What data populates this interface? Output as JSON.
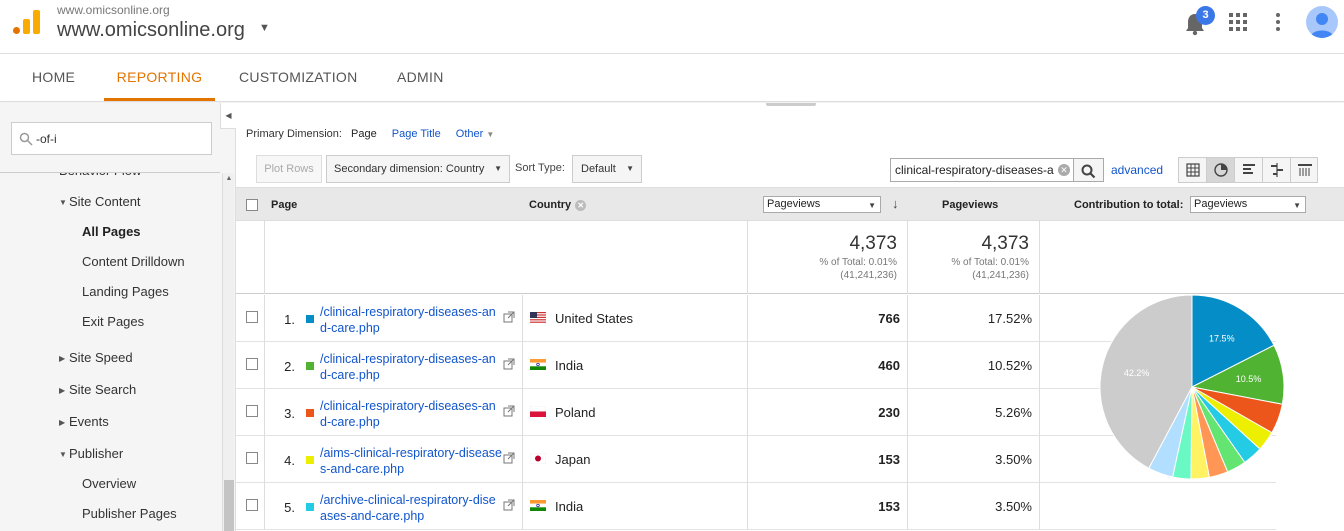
{
  "header": {
    "site_small": "www.omicsonline.org",
    "site_big": "www.omicsonline.org",
    "notification_count": "3"
  },
  "nav": {
    "tabs": [
      "HOME",
      "REPORTING",
      "CUSTOMIZATION",
      "ADMIN"
    ],
    "active": "REPORTING"
  },
  "sidebar": {
    "search_value": "-of-i",
    "items": [
      {
        "label": "Behavior Flow",
        "level": 1
      },
      {
        "label": "Site Content",
        "level": 1,
        "expanded": true
      },
      {
        "label": "All Pages",
        "level": 2,
        "active": true
      },
      {
        "label": "Content Drilldown",
        "level": 2
      },
      {
        "label": "Landing Pages",
        "level": 2
      },
      {
        "label": "Exit Pages",
        "level": 2
      },
      {
        "label": "Site Speed",
        "level": 1
      },
      {
        "label": "Site Search",
        "level": 1
      },
      {
        "label": "Events",
        "level": 1
      },
      {
        "label": "Publisher",
        "level": 1,
        "expanded": true
      },
      {
        "label": "Overview",
        "level": 2
      },
      {
        "label": "Publisher Pages",
        "level": 2
      }
    ]
  },
  "main": {
    "primary_dimension_label": "Primary Dimension:",
    "primary_dimension_options": [
      "Page",
      "Page Title",
      "Other"
    ],
    "plot_rows_label": "Plot Rows",
    "secondary_dimension_label": "Secondary dimension: Country",
    "sort_type_label": "Sort Type:",
    "sort_type_value": "Default",
    "filter_value": "clinical-respiratory-diseases-a",
    "advanced_label": "advanced"
  },
  "table": {
    "col_page": "Page",
    "col_country": "Country",
    "metric_select": "Pageviews",
    "col_pageviews": "Pageviews",
    "col_contribution": "Contribution to total:",
    "contribution_select": "Pageviews",
    "totals": {
      "value1": "4,373",
      "pct1": "% of Total: 0.01%",
      "abs1": "(41,241,236)",
      "value2": "4,373",
      "pct2": "% of Total: 0.01%",
      "abs2": "(41,241,236)"
    },
    "rows": [
      {
        "idx": "1.",
        "page": "/clinical-respiratory-diseases-and-care.php",
        "country": "United States",
        "pageviews": "766",
        "percent": "17.52%",
        "color": "#058dc7",
        "flag": "us"
      },
      {
        "idx": "2.",
        "page": "/clinical-respiratory-diseases-and-care.php",
        "country": "India",
        "pageviews": "460",
        "percent": "10.52%",
        "color": "#50b432",
        "flag": "in"
      },
      {
        "idx": "3.",
        "page": "/clinical-respiratory-diseases-and-care.php",
        "country": "Poland",
        "pageviews": "230",
        "percent": "5.26%",
        "color": "#ed561b",
        "flag": "pl"
      },
      {
        "idx": "4.",
        "page": "/aims-clinical-respiratory-diseases-and-care.php",
        "country": "Japan",
        "pageviews": "153",
        "percent": "3.50%",
        "color": "#edef00",
        "flag": "jp"
      },
      {
        "idx": "5.",
        "page": "/archive-clinical-respiratory-diseases-and-care.php",
        "country": "India",
        "pageviews": "153",
        "percent": "3.50%",
        "color": "#24cbe5",
        "flag": "in"
      }
    ]
  },
  "chart_data": {
    "type": "pie",
    "slices": [
      {
        "value": 17.5,
        "label": "17.5%",
        "color": "#058dc7"
      },
      {
        "value": 10.5,
        "label": "10.5%",
        "color": "#50b432"
      },
      {
        "value": 5.26,
        "label": "",
        "color": "#ed561b"
      },
      {
        "value": 3.5,
        "label": "",
        "color": "#edef00"
      },
      {
        "value": 3.5,
        "label": "",
        "color": "#24cbe5"
      },
      {
        "value": 3.4,
        "label": "",
        "color": "#64e572"
      },
      {
        "value": 3.3,
        "label": "",
        "color": "#ff9655"
      },
      {
        "value": 3.2,
        "label": "",
        "color": "#fff263"
      },
      {
        "value": 3.2,
        "label": "",
        "color": "#6af9c4"
      },
      {
        "value": 4.4,
        "label": "",
        "color": "#b2deff"
      },
      {
        "value": 42.2,
        "label": "42.2%",
        "color": "#cccccc"
      }
    ]
  }
}
